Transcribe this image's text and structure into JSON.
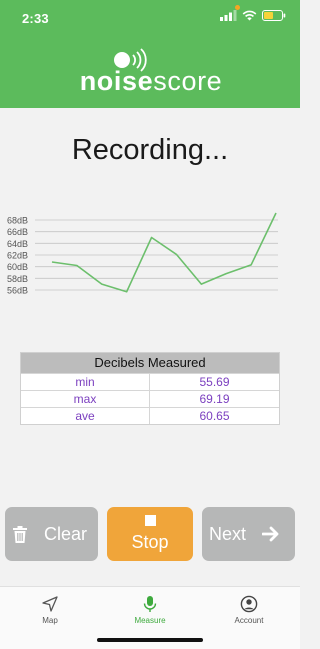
{
  "status_bar": {
    "time": "2:33"
  },
  "logo": {
    "text": "noisescore"
  },
  "title": "Recording...",
  "chart_data": {
    "type": "line",
    "y_ticks": [
      "68dB",
      "66dB",
      "64dB",
      "62dB",
      "60dB",
      "58dB",
      "56dB"
    ],
    "ylim": [
      56,
      68
    ],
    "x": [
      1,
      2,
      3,
      4,
      5,
      6,
      7,
      8,
      9
    ],
    "series": [
      {
        "values": [
          60.8,
          60.2,
          57.0,
          55.7,
          65.0,
          62.1,
          57.0,
          58.8,
          60.3,
          69.2
        ]
      }
    ],
    "color": "#6cbf6c",
    "grid": true
  },
  "table": {
    "title": "Decibels Measured",
    "rows": [
      {
        "label": "min",
        "value": "55.69"
      },
      {
        "label": "max",
        "value": "69.19"
      },
      {
        "label": "ave",
        "value": "60.65"
      }
    ]
  },
  "buttons": {
    "clear": "Clear",
    "stop": "Stop",
    "next": "Next"
  },
  "tabs": [
    {
      "label": "Map",
      "icon": "navigation-arrow-icon"
    },
    {
      "label": "Measure",
      "icon": "microphone-icon",
      "active": true
    },
    {
      "label": "Account",
      "icon": "account-icon"
    }
  ],
  "colors": {
    "header": "#5cbb5c",
    "stop": "#f0a53a",
    "gray_button": "#b6b7b7",
    "value_text": "#7b3fbf",
    "active_tab": "#3eaa3e"
  }
}
